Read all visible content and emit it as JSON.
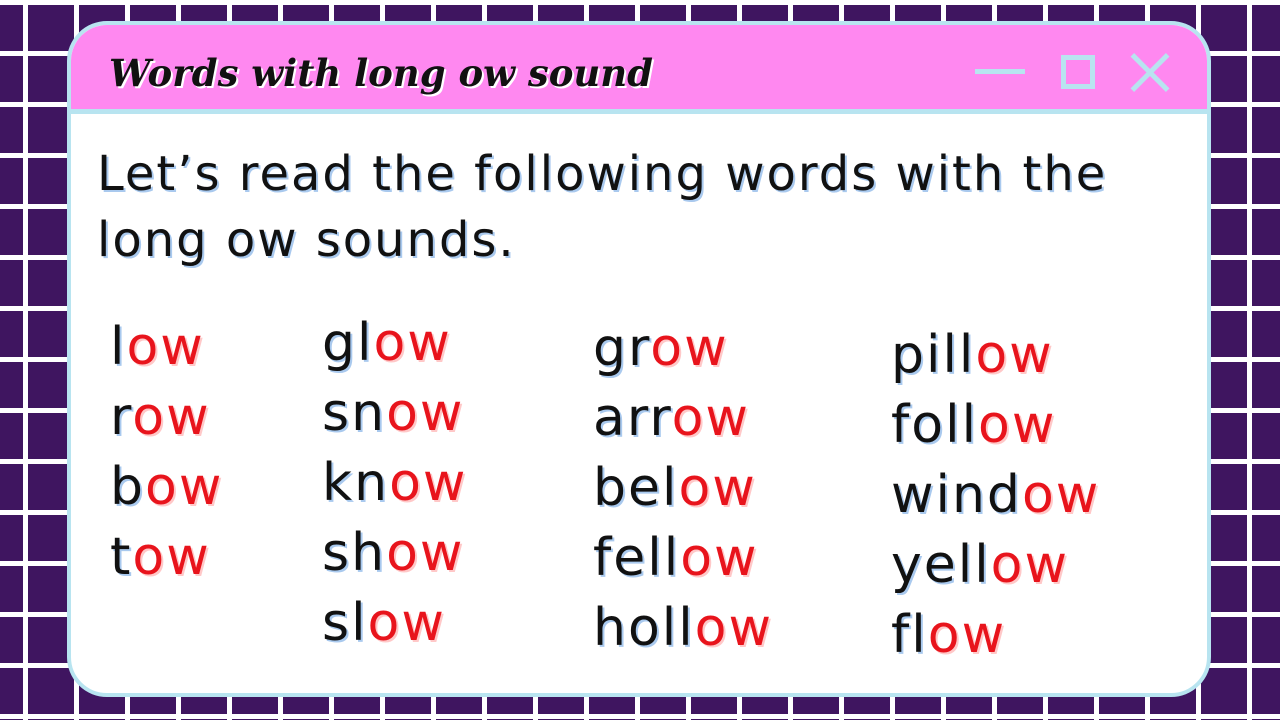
{
  "window": {
    "title": "Words with long ow sound",
    "controls": {
      "minimize": "minimize-icon",
      "maximize": "maximize-icon",
      "close": "close-icon"
    }
  },
  "instruction": "Let’s read the following words with the long ow sounds.",
  "colors": {
    "background": "#3f1560",
    "grid_lines": "#ffffff",
    "titlebar": "#ff88f0",
    "border": "#b8e4f0",
    "word_text": "#111111",
    "highlight": "#e8141c"
  },
  "word_columns": [
    [
      {
        "prefix": "l",
        "suffix": "ow"
      },
      {
        "prefix": "r",
        "suffix": "ow"
      },
      {
        "prefix": "b",
        "suffix": "ow"
      },
      {
        "prefix": "t",
        "suffix": "ow"
      }
    ],
    [
      {
        "prefix": "gl",
        "suffix": "ow"
      },
      {
        "prefix": "sn",
        "suffix": "ow"
      },
      {
        "prefix": "kn",
        "suffix": "ow"
      },
      {
        "prefix": "sh",
        "suffix": "ow"
      },
      {
        "prefix": "sl",
        "suffix": "ow"
      }
    ],
    [
      {
        "prefix": "gr",
        "suffix": "ow"
      },
      {
        "prefix": "arr",
        "suffix": "ow"
      },
      {
        "prefix": "bel",
        "suffix": "ow"
      },
      {
        "prefix": "fell",
        "suffix": "ow"
      },
      {
        "prefix": "holl",
        "suffix": "ow"
      }
    ],
    [
      {
        "prefix": "pill",
        "suffix": "ow"
      },
      {
        "prefix": "foll",
        "suffix": "ow"
      },
      {
        "prefix": "wind",
        "suffix": "ow"
      },
      {
        "prefix": "yell",
        "suffix": "ow"
      },
      {
        "prefix": "fl",
        "suffix": "ow"
      }
    ]
  ]
}
